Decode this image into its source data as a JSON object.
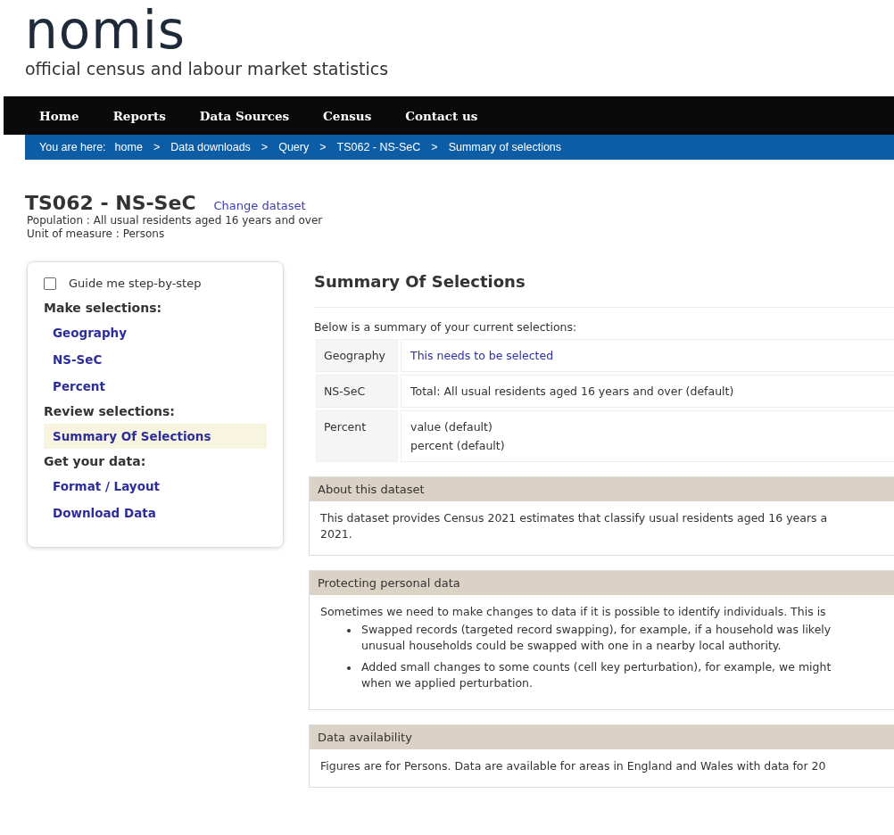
{
  "logo": {
    "title": "nomis",
    "tagline": "official census and labour market statistics"
  },
  "nav": [
    "Home",
    "Reports",
    "Data Sources",
    "Census",
    "Contact us"
  ],
  "breadcrumb": {
    "prefix": "You are here:",
    "separator": ">",
    "items": [
      "home",
      "Data downloads",
      "Query",
      "TS062 - NS-SeC",
      "Summary of selections"
    ]
  },
  "dataset": {
    "title": "TS062 - NS-SeC",
    "change_link": "Change dataset",
    "meta": [
      "Population : All usual residents aged 16 years and over",
      "Unit of measure : Persons"
    ]
  },
  "sidebar": {
    "guide": {
      "label": "Guide me step-by-step",
      "checked": false
    },
    "sections": [
      {
        "heading": "Make selections:",
        "items": [
          {
            "label": "Geography",
            "selected": false
          },
          {
            "label": "NS-SeC",
            "selected": false
          },
          {
            "label": "Percent",
            "selected": false
          }
        ]
      },
      {
        "heading": "Review selections:",
        "items": [
          {
            "label": "Summary Of Selections",
            "selected": true
          }
        ]
      },
      {
        "heading": "Get your data:",
        "items": [
          {
            "label": "Format / Layout",
            "selected": false
          },
          {
            "label": "Download Data",
            "selected": false
          }
        ]
      }
    ]
  },
  "summary": {
    "title": "Summary Of Selections",
    "intro": "Below is a summary of your current selections:",
    "rows": [
      {
        "label": "Geography",
        "kind": "missing",
        "values": [
          "This needs to be selected"
        ]
      },
      {
        "label": "NS-SeC",
        "kind": "set",
        "values": [
          "Total: All usual residents aged 16 years and over (default)"
        ]
      },
      {
        "label": "Percent",
        "kind": "set",
        "values": [
          "value (default)",
          "percent (default)"
        ]
      }
    ]
  },
  "panels": [
    {
      "title": "About this dataset",
      "blocks": [
        {
          "kind": "text",
          "lines": [
            "This dataset provides Census 2021 estimates that classify usual residents aged 16 years a",
            "2021."
          ]
        }
      ]
    },
    {
      "title": "Protecting personal data",
      "blocks": [
        {
          "kind": "text",
          "lines": [
            "Sometimes we need to make changes to data if it is possible to identify individuals. This is"
          ]
        },
        {
          "kind": "bullet",
          "lines": [
            "Swapped records (targeted record swapping), for example, if a household was likely",
            "unusual households could be swapped with one in a nearby local authority."
          ]
        },
        {
          "kind": "bullet",
          "lines": [
            "Added small changes to some counts (cell key perturbation), for example, we might",
            "when we applied perturbation."
          ]
        }
      ]
    },
    {
      "title": "Data availability",
      "blocks": [
        {
          "kind": "text",
          "lines": [
            "Figures are for Persons. Data are available for areas in England and Wales with data for 20"
          ]
        }
      ]
    }
  ]
}
